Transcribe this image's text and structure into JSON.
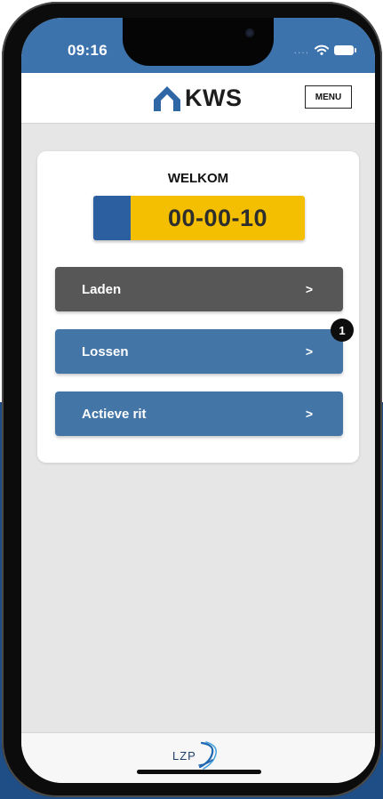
{
  "status_bar": {
    "time": "09:16",
    "signal_dots": "....",
    "wifi_icon": "wifi-icon",
    "battery_icon": "battery-icon"
  },
  "header": {
    "logo_text": "KWS",
    "logo_icon": "kws-house-icon",
    "menu_label": "MENU"
  },
  "card": {
    "welcome": "WELKOM",
    "plate": "00-00-10",
    "options": [
      {
        "label": "Laden",
        "chevron": ">",
        "color": "#575757"
      },
      {
        "label": "Lossen",
        "chevron": ">",
        "badge": "1",
        "color": "#4475a7"
      },
      {
        "label": "Actieve rit",
        "chevron": ">",
        "color": "#4475a7"
      }
    ]
  },
  "footer": {
    "logo_text": "LZP",
    "logo_icon": "lzp-swoosh-icon"
  },
  "colors": {
    "header_blue": "#3d73ad",
    "plate_yellow": "#f4bf00",
    "plate_blue": "#2b5f9f",
    "background_blue": "#1f4e86"
  }
}
